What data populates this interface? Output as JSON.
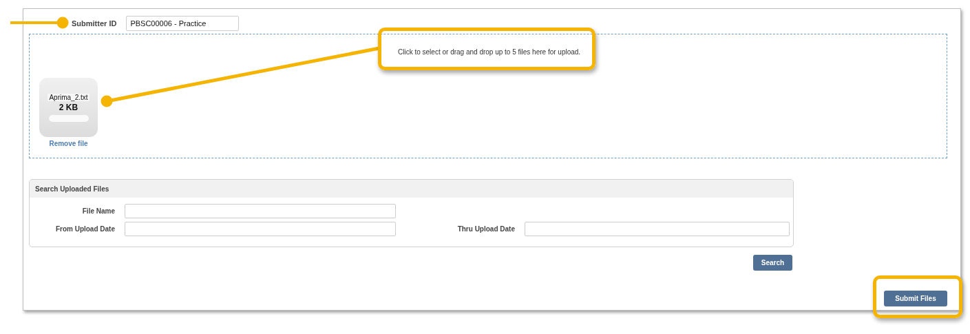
{
  "submitter": {
    "label": "Submitter ID",
    "value": "PBSC00006 - Practice"
  },
  "dropzone": {
    "hint": "Click to select or drag and drop up to 5 files here for upload.",
    "files": [
      {
        "name": "Aprima_2.txt",
        "size": "2 KB",
        "level": 1,
        "remove": "Remove file"
      }
    ]
  },
  "search_panel": {
    "title": "Search Uploaded Files",
    "fields": [
      {
        "label": "File Name"
      },
      {
        "label": "From Upload Date"
      },
      {
        "label": "Thru Upload Date"
      }
    ],
    "button": "Search"
  },
  "submit_button": "Submit Files"
}
